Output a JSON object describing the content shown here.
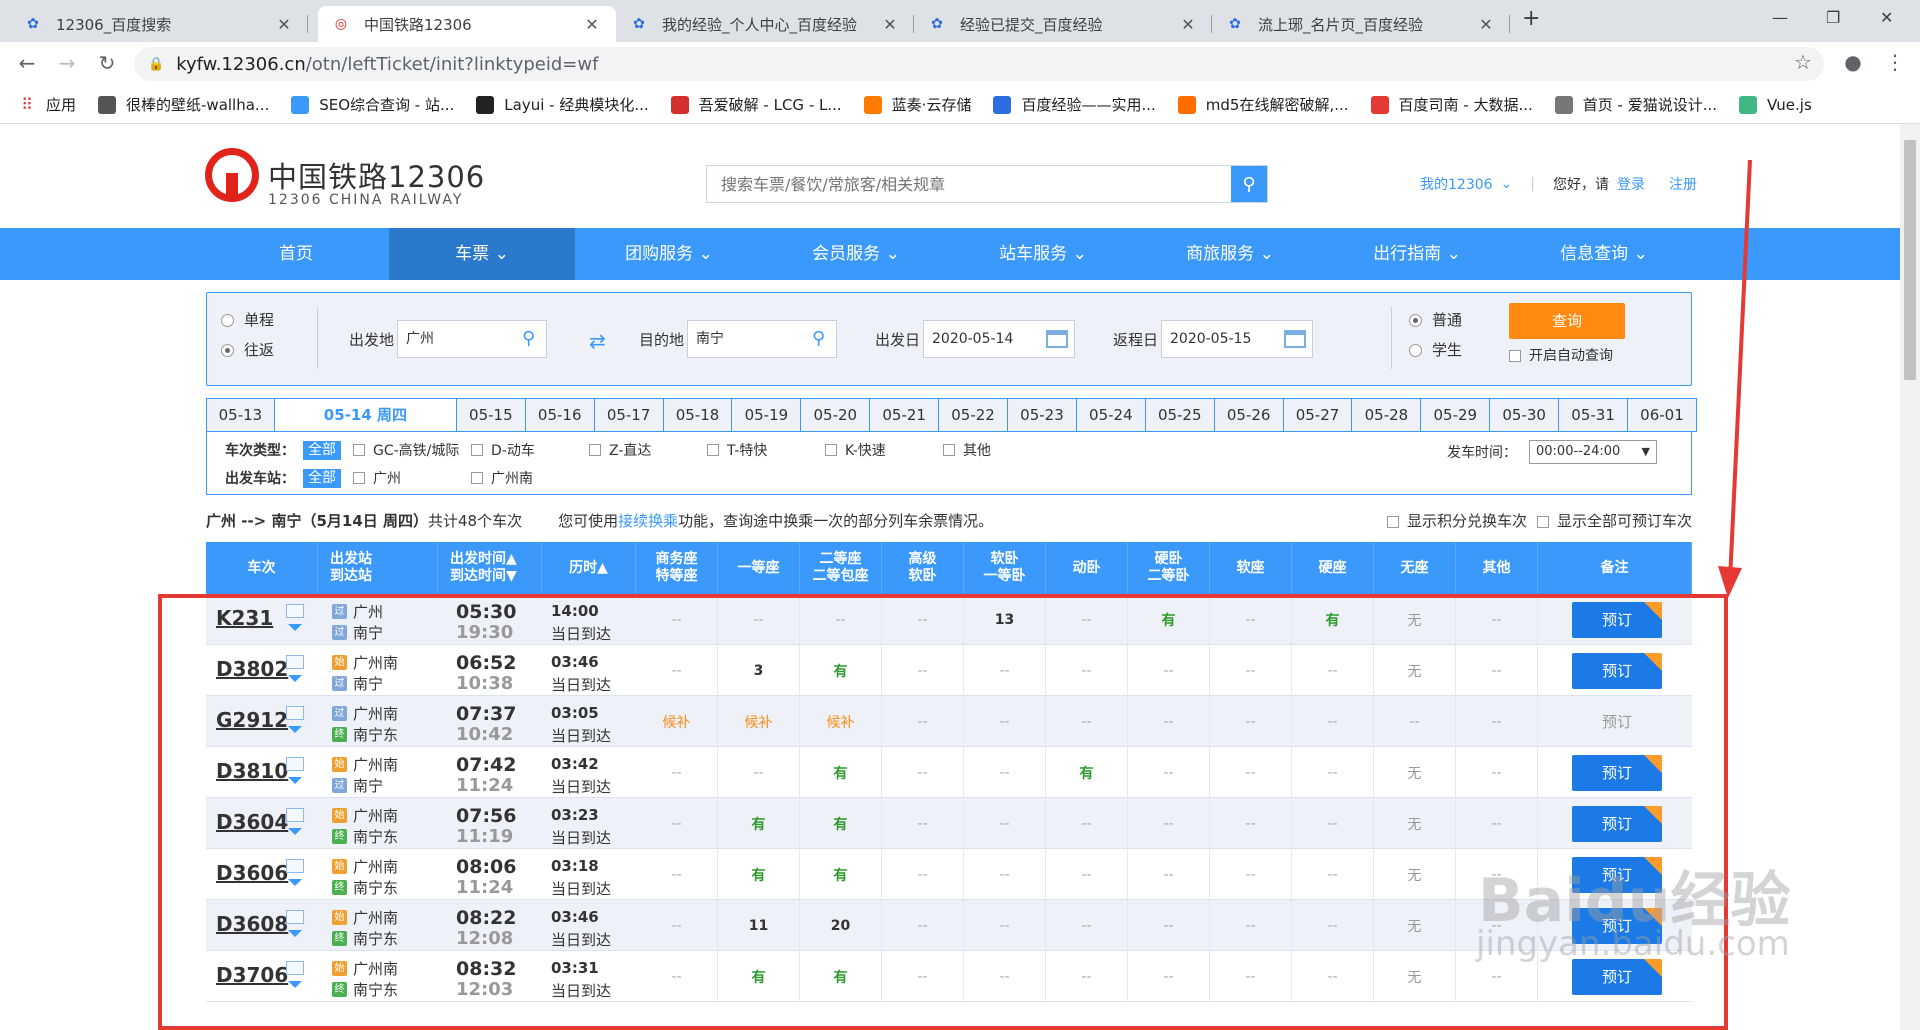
{
  "browser": {
    "tabs": [
      {
        "title": "12306_百度搜索",
        "icon": "baidu-paw-icon"
      },
      {
        "title": "中国铁路12306",
        "icon": "railway-logo-icon",
        "active": true
      },
      {
        "title": "我的经验_个人中心_百度经验",
        "icon": "baidu-paw-icon"
      },
      {
        "title": "经验已提交_百度经验",
        "icon": "baidu-paw-icon"
      },
      {
        "title": "流上琊_名片页_百度经验",
        "icon": "baidu-paw-icon"
      }
    ],
    "url_host": "kyfw.12306.cn",
    "url_path": "/otn/leftTicket/init?linktypeid=wf",
    "bookmarks": [
      {
        "label": "应用",
        "icon": "apps-grid-icon"
      },
      {
        "label": "很棒的壁纸-wallha...",
        "icon": "wallhaven-icon"
      },
      {
        "label": "SEO综合查询 - 站...",
        "icon": "seo-icon"
      },
      {
        "label": "Layui - 经典模块化...",
        "icon": "layui-icon"
      },
      {
        "label": "吾爱破解 - LCG - L...",
        "icon": "52pojie-icon"
      },
      {
        "label": "蓝奏·云存储",
        "icon": "lanzou-icon"
      },
      {
        "label": "百度经验——实用...",
        "icon": "baidu-paw-icon"
      },
      {
        "label": "md5在线解密破解,...",
        "icon": "md5-icon"
      },
      {
        "label": "百度司南 - 大数据...",
        "icon": "sinan-icon"
      },
      {
        "label": "首页 - 爱猫说设计...",
        "icon": "cat-icon"
      },
      {
        "label": "Vue.js",
        "icon": "vue-icon"
      }
    ]
  },
  "header": {
    "logo_cn": "中国铁路12306",
    "logo_en": "12306 CHINA RAILWAY",
    "search_placeholder": "搜索车票/餐饮/常旅客/相关规章",
    "my12306": "我的12306",
    "greeting": "您好，请",
    "login": "登录",
    "register": "注册"
  },
  "nav": [
    {
      "label": "首页"
    },
    {
      "label": "车票",
      "active": true
    },
    {
      "label": "团购服务"
    },
    {
      "label": "会员服务"
    },
    {
      "label": "站车服务"
    },
    {
      "label": "商旅服务"
    },
    {
      "label": "出行指南"
    },
    {
      "label": "信息查询"
    }
  ],
  "query": {
    "oneway": "单程",
    "roundtrip": "往返",
    "from_label": "出发地",
    "from_value": "广州",
    "to_label": "目的地",
    "to_value": "南宁",
    "depart_label": "出发日",
    "depart_value": "2020-05-14",
    "return_label": "返程日",
    "return_value": "2020-05-15",
    "normal": "普通",
    "student": "学生",
    "query_button": "查询",
    "auto_query": "开启自动查询"
  },
  "dates": [
    "05-13",
    "05-14 周四",
    "05-15",
    "05-16",
    "05-17",
    "05-18",
    "05-19",
    "05-20",
    "05-21",
    "05-22",
    "05-23",
    "05-24",
    "05-25",
    "05-26",
    "05-27",
    "05-28",
    "05-29",
    "05-30",
    "05-31",
    "06-01"
  ],
  "filters": {
    "type_label": "车次类型：",
    "station_label": "出发车站：",
    "all": "全部",
    "types": [
      "GC-高铁/城际",
      "D-动车",
      "Z-直达",
      "T-特快",
      "K-快速",
      "其他"
    ],
    "stations": [
      "广州",
      "广州南"
    ],
    "time_label": "发车时间：",
    "time_value": "00:00--24:00"
  },
  "summary": {
    "route": "广州 --> 南宁（5月14日  周四）",
    "count_text": "共计48个车次",
    "hint_pre": "您可使用",
    "hint_link": "接续换乘",
    "hint_post": "功能，查询途中换乘一次的部分列车余票情况。",
    "opt_points": "显示积分兑换车次",
    "opt_all": "显示全部可预订车次"
  },
  "table_headers": [
    {
      "l1": "车次",
      "l2": ""
    },
    {
      "l1": "出发站",
      "l2": "到达站"
    },
    {
      "l1": "出发时间▲",
      "l2": "到达时间▼"
    },
    {
      "l1": "历时▲",
      "l2": ""
    },
    {
      "l1": "商务座",
      "l2": "特等座"
    },
    {
      "l1": "一等座",
      "l2": ""
    },
    {
      "l1": "二等座",
      "l2": "二等包座"
    },
    {
      "l1": "高级",
      "l2": "软卧"
    },
    {
      "l1": "软卧",
      "l2": "一等卧"
    },
    {
      "l1": "动卧",
      "l2": ""
    },
    {
      "l1": "硬卧",
      "l2": "二等卧"
    },
    {
      "l1": "软座",
      "l2": ""
    },
    {
      "l1": "硬座",
      "l2": ""
    },
    {
      "l1": "无座",
      "l2": ""
    },
    {
      "l1": "其他",
      "l2": ""
    },
    {
      "l1": "备注",
      "l2": ""
    }
  ],
  "trains": [
    {
      "no": "K231",
      "from": "广州",
      "from_badge": "过",
      "to": "南宁",
      "to_badge": "过",
      "dep": "05:30",
      "arr": "19:30",
      "dur": "14:00",
      "day": "当日到达",
      "seats": [
        "--",
        "--",
        "--",
        "--",
        "13",
        "--",
        "有",
        "--",
        "有",
        "无",
        "--"
      ],
      "book": "预订"
    },
    {
      "no": "D3802",
      "from": "广州南",
      "from_badge": "始",
      "to": "南宁",
      "to_badge": "过",
      "dep": "06:52",
      "arr": "10:38",
      "dur": "03:46",
      "day": "当日到达",
      "seats": [
        "--",
        "3",
        "有",
        "--",
        "--",
        "--",
        "--",
        "--",
        "--",
        "无",
        "--"
      ],
      "book": "预订"
    },
    {
      "no": "G2912",
      "from": "广州南",
      "from_badge": "过",
      "to": "南宁东",
      "to_badge": "终",
      "dep": "07:37",
      "arr": "10:42",
      "dur": "03:05",
      "day": "当日到达",
      "seats": [
        "候补",
        "候补",
        "候补",
        "--",
        "--",
        "--",
        "--",
        "--",
        "--",
        "--",
        "--"
      ],
      "book": "预订"
    },
    {
      "no": "D3810",
      "from": "广州南",
      "from_badge": "始",
      "to": "南宁",
      "to_badge": "过",
      "dep": "07:42",
      "arr": "11:24",
      "dur": "03:42",
      "day": "当日到达",
      "seats": [
        "--",
        "--",
        "有",
        "--",
        "--",
        "有",
        "--",
        "--",
        "--",
        "无",
        "--"
      ],
      "book": "预订"
    },
    {
      "no": "D3604",
      "from": "广州南",
      "from_badge": "始",
      "to": "南宁东",
      "to_badge": "终",
      "dep": "07:56",
      "arr": "11:19",
      "dur": "03:23",
      "day": "当日到达",
      "seats": [
        "--",
        "有",
        "有",
        "--",
        "--",
        "--",
        "--",
        "--",
        "--",
        "无",
        "--"
      ],
      "book": "预订"
    },
    {
      "no": "D3606",
      "from": "广州南",
      "from_badge": "始",
      "to": "南宁东",
      "to_badge": "终",
      "dep": "08:06",
      "arr": "11:24",
      "dur": "03:18",
      "day": "当日到达",
      "seats": [
        "--",
        "有",
        "有",
        "--",
        "--",
        "--",
        "--",
        "--",
        "--",
        "无",
        "--"
      ],
      "book": "预订"
    },
    {
      "no": "D3608",
      "from": "广州南",
      "from_badge": "始",
      "to": "南宁东",
      "to_badge": "终",
      "dep": "08:22",
      "arr": "12:08",
      "dur": "03:46",
      "day": "当日到达",
      "seats": [
        "--",
        "11",
        "20",
        "--",
        "--",
        "--",
        "--",
        "--",
        "--",
        "无",
        "--"
      ],
      "book": "预订"
    },
    {
      "no": "D3706",
      "from": "广州南",
      "from_badge": "始",
      "to": "南宁东",
      "to_badge": "终",
      "dep": "08:32",
      "arr": "12:03",
      "dur": "03:31",
      "day": "当日到达",
      "seats": [
        "--",
        "有",
        "有",
        "--",
        "--",
        "--",
        "--",
        "--",
        "--",
        "无",
        "--"
      ],
      "book": "预订"
    }
  ],
  "watermark": {
    "text1": "Baidu经验",
    "text2": "jingyan.baidu.com"
  },
  "colors": {
    "primary": "#3b99fc",
    "accent": "#ff8a12",
    "annotation": "#e53935",
    "available": "#2e9a2e"
  }
}
